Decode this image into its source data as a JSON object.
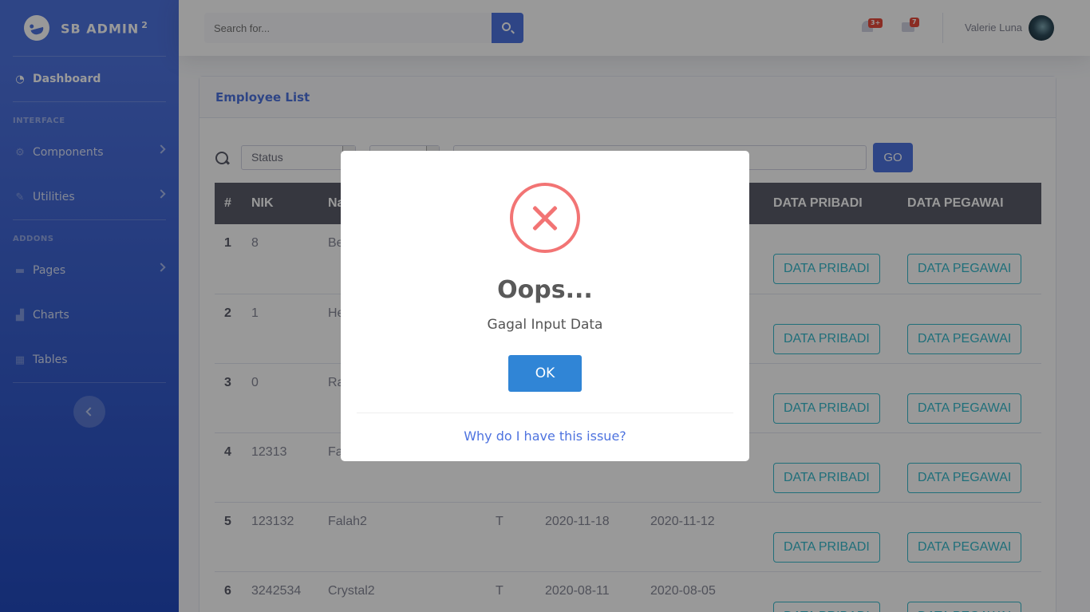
{
  "brand": {
    "name": "SB ADMIN",
    "sup": "2"
  },
  "sidebar": {
    "dashboard": "Dashboard",
    "heading_interface": "INTERFACE",
    "components": "Components",
    "utilities": "Utilities",
    "heading_addons": "ADDONS",
    "pages": "Pages",
    "charts": "Charts",
    "tables": "Tables"
  },
  "topbar": {
    "search_placeholder": "Search for...",
    "alerts_badge": "3+",
    "messages_badge": "7",
    "user_name": "Valerie Luna"
  },
  "card": {
    "title": "Employee List",
    "filter_status": "Status",
    "go_label": "GO"
  },
  "table": {
    "headers": {
      "num": "#",
      "nik": "NIK",
      "name": "Na",
      "data_pribadi": "DATA PRIBADI",
      "data_pegawai": "DATA PEGAWAI"
    },
    "rows": [
      {
        "num": "1",
        "nik": "8",
        "name": "Be",
        "gender": "",
        "date1": "",
        "date2": "",
        "btn1": "DATA PRIBADI",
        "btn2": "DATA PEGAWAI"
      },
      {
        "num": "2",
        "nik": "1",
        "name": "He",
        "gender": "",
        "date1": "",
        "date2": "",
        "btn1": "DATA PRIBADI",
        "btn2": "DATA PEGAWAI"
      },
      {
        "num": "3",
        "nik": "0",
        "name": "Ra",
        "gender": "",
        "date1": "",
        "date2": "",
        "btn1": "DATA PRIBADI",
        "btn2": "DATA PEGAWAI"
      },
      {
        "num": "4",
        "nik": "12313",
        "name": "Fa",
        "gender": "",
        "date1": "",
        "date2": "",
        "btn1": "DATA PRIBADI",
        "btn2": "DATA PEGAWAI"
      },
      {
        "num": "5",
        "nik": "123132",
        "name": "Falah2",
        "gender": "T",
        "date1": "2020-11-18",
        "date2": "2020-11-12",
        "btn1": "DATA PRIBADI",
        "btn2": "DATA PEGAWAI"
      },
      {
        "num": "6",
        "nik": "3242534",
        "name": "Crystal2",
        "gender": "T",
        "date1": "2020-08-11",
        "date2": "2020-08-05",
        "btn1": "DATA PRIBADI",
        "btn2": "DATA PEGAWAI"
      }
    ]
  },
  "modal": {
    "title": "Oops...",
    "text": "Gagal Input Data",
    "ok_label": "OK",
    "footer_link": "Why do I have this issue?"
  },
  "colors": {
    "primary": "#4e73df",
    "info": "#36b9cc",
    "error": "#f27474",
    "confirm": "#3085d6"
  }
}
